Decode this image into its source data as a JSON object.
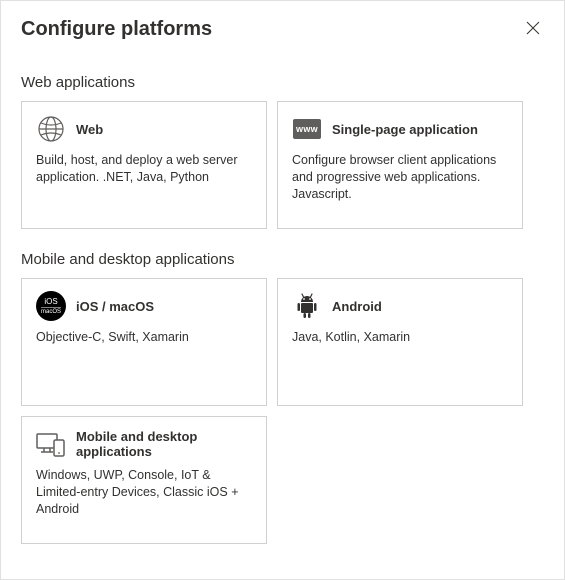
{
  "header": {
    "title": "Configure platforms"
  },
  "sections": {
    "web": {
      "title": "Web applications",
      "cards": {
        "web": {
          "title": "Web",
          "desc": "Build, host, and deploy a web server application. .NET, Java, Python"
        },
        "spa": {
          "title": "Single-page application",
          "badge": "www",
          "desc": "Configure browser client applications and progressive web applications. Javascript."
        }
      }
    },
    "mobile": {
      "title": "Mobile and desktop applications",
      "cards": {
        "ios": {
          "title": "iOS / macOS",
          "badge_line1": "iOS",
          "badge_line2": "macOS",
          "desc": "Objective-C, Swift, Xamarin"
        },
        "android": {
          "title": "Android",
          "desc": "Java, Kotlin, Xamarin"
        },
        "desktop": {
          "title": "Mobile and desktop applications",
          "desc": "Windows, UWP, Console, IoT & Limited-entry Devices, Classic iOS + Android"
        }
      }
    }
  }
}
